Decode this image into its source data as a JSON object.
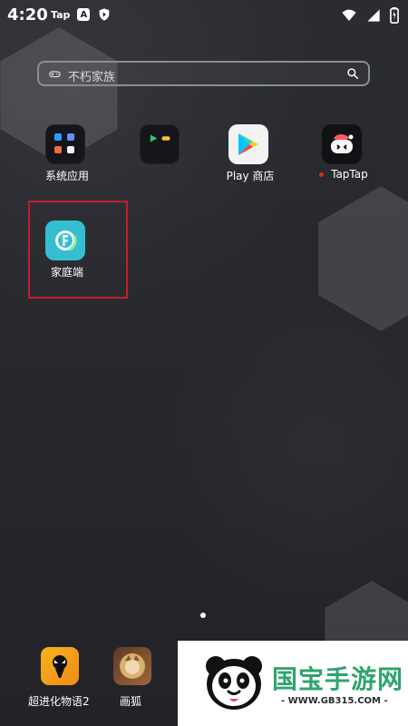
{
  "status": {
    "time": "4:20",
    "left_badges": [
      "Tap",
      "A"
    ],
    "right_icons": [
      "wifi-icon",
      "signal-icon",
      "battery-icon"
    ]
  },
  "search": {
    "placeholder": "不朽家族"
  },
  "apps": [
    {
      "label": "系统应用"
    },
    {
      "label": ""
    },
    {
      "label": "Play 商店"
    },
    {
      "label": "TapTap"
    },
    {
      "label": "家庭端"
    }
  ],
  "dock": [
    {
      "label": "超进化物语2"
    },
    {
      "label": "画狐"
    }
  ],
  "watermark": {
    "title": "国宝手游网",
    "url": "- WWW.GB315.COM -"
  }
}
